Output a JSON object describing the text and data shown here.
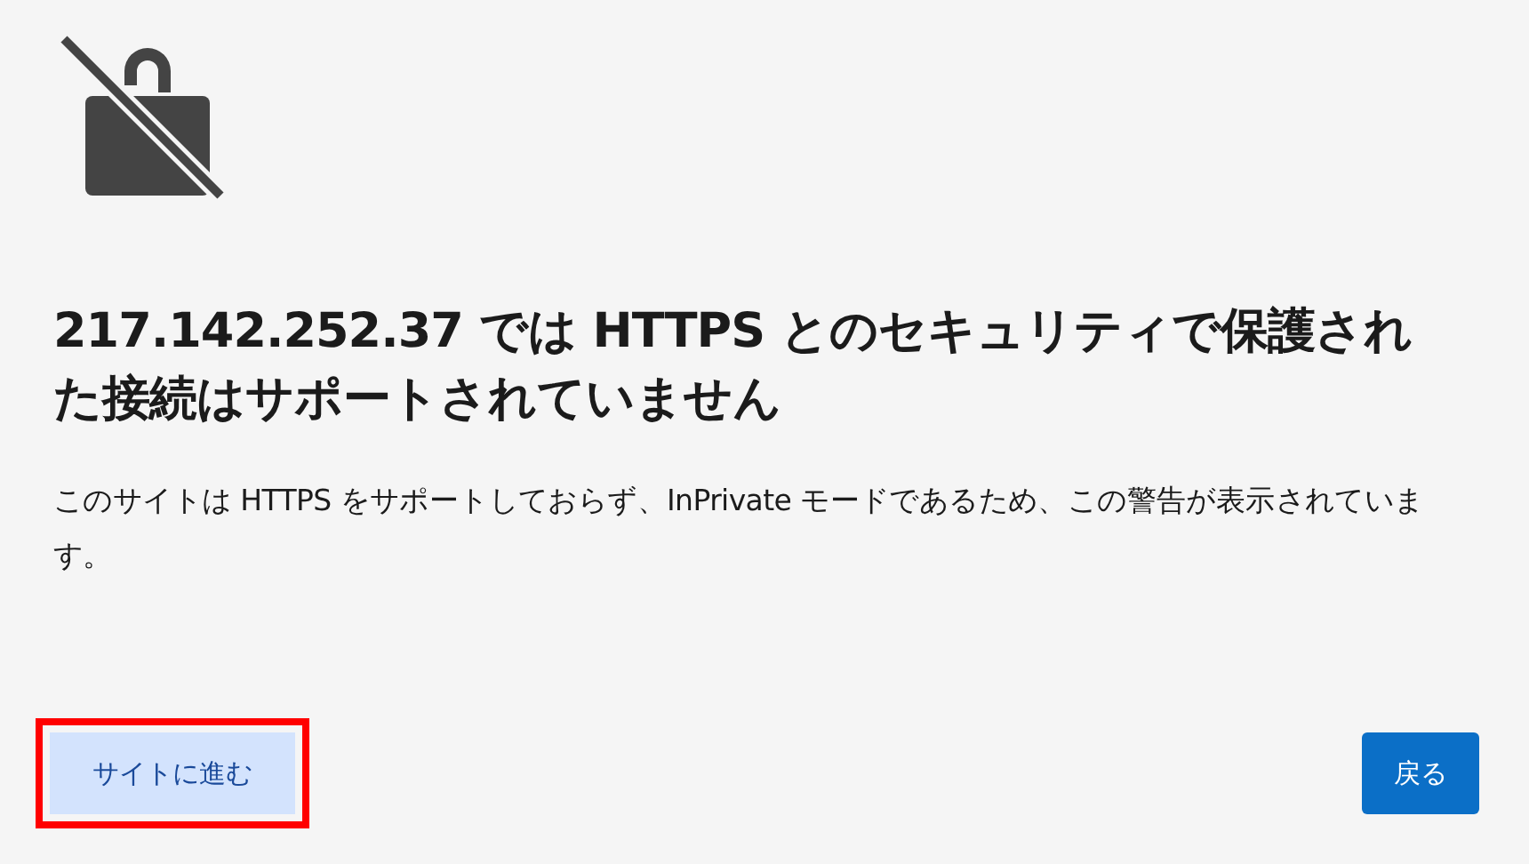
{
  "title": "217.142.252.37 では HTTPS とのセキュリティで保護された接続はサポートされていません",
  "message": "このサイトは HTTPS をサポートしておらず、InPrivate モードであるため、この警告が表示されています。",
  "buttons": [
    {
      "label": "サイトに進む",
      "kind": "secondary",
      "highlighted": true
    },
    {
      "label": "戻る",
      "kind": "primary",
      "highlighted": false
    }
  ]
}
